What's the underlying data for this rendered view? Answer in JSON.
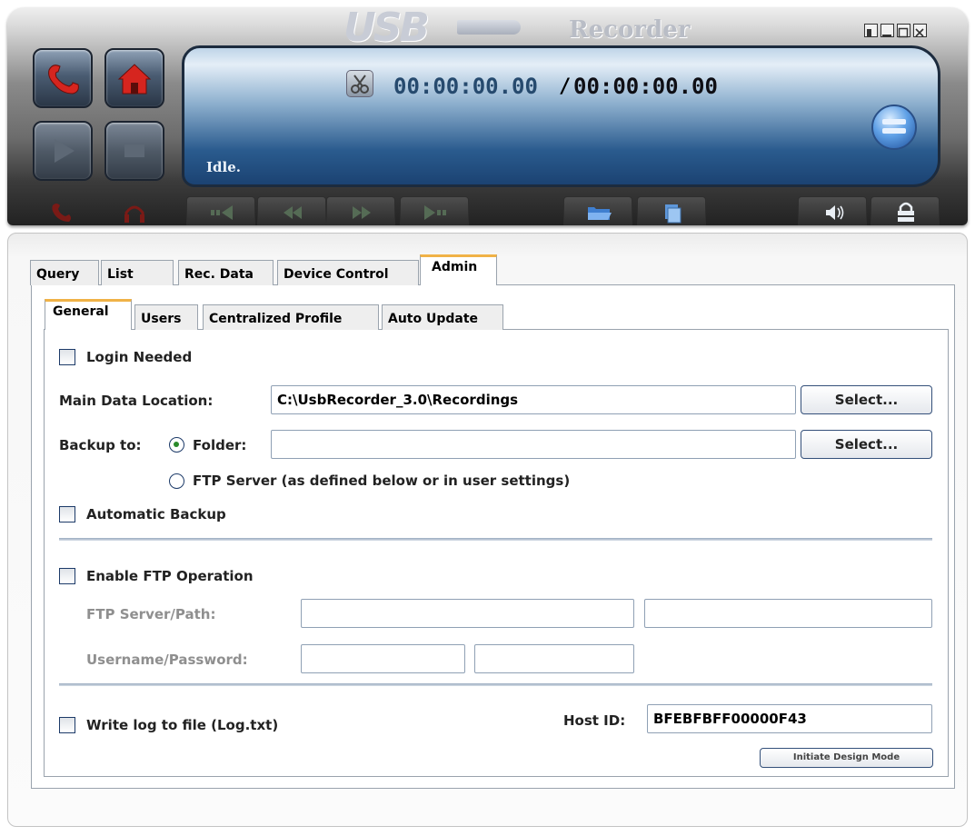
{
  "app": {
    "logo_usb": "USB",
    "logo_title": "Recorder"
  },
  "player": {
    "time_current": "00:00:00.00",
    "time_separator": "/",
    "time_total": "00:00:00.00",
    "status": "Idle."
  },
  "tabs": {
    "query": "Query",
    "list": "List",
    "rec_data": "Rec. Data",
    "device_control": "Device Control",
    "admin": "Admin"
  },
  "subtabs": {
    "general": "General",
    "users": "Users",
    "centralized_profile": "Centralized Profile",
    "auto_update": "Auto Update"
  },
  "general": {
    "login_needed": {
      "label": "Login Needed",
      "checked": false
    },
    "main_data_location": {
      "label": "Main Data Location:",
      "value": "C:\\UsbRecorder_3.0\\Recordings",
      "button": "Select..."
    },
    "backup": {
      "label": "Backup to:",
      "folder_option": "Folder:",
      "folder_value": "",
      "button": "Select...",
      "ftp_option": "FTP Server (as defined below or in user settings)",
      "selected": "folder"
    },
    "automatic_backup": {
      "label": "Automatic Backup",
      "checked": false
    },
    "enable_ftp": {
      "label": "Enable FTP Operation",
      "checked": false
    },
    "ftp_server_path": {
      "label": "FTP Server/Path:",
      "server": "",
      "path": ""
    },
    "username_password": {
      "label": "Username/Password:",
      "username": "",
      "password": ""
    },
    "write_log": {
      "label": "Write log to file (Log.txt)",
      "checked": false
    },
    "host_id": {
      "label": "Host ID:",
      "value": "BFEBFBFF00000F43"
    },
    "design_button": "Initiate Design Mode"
  }
}
